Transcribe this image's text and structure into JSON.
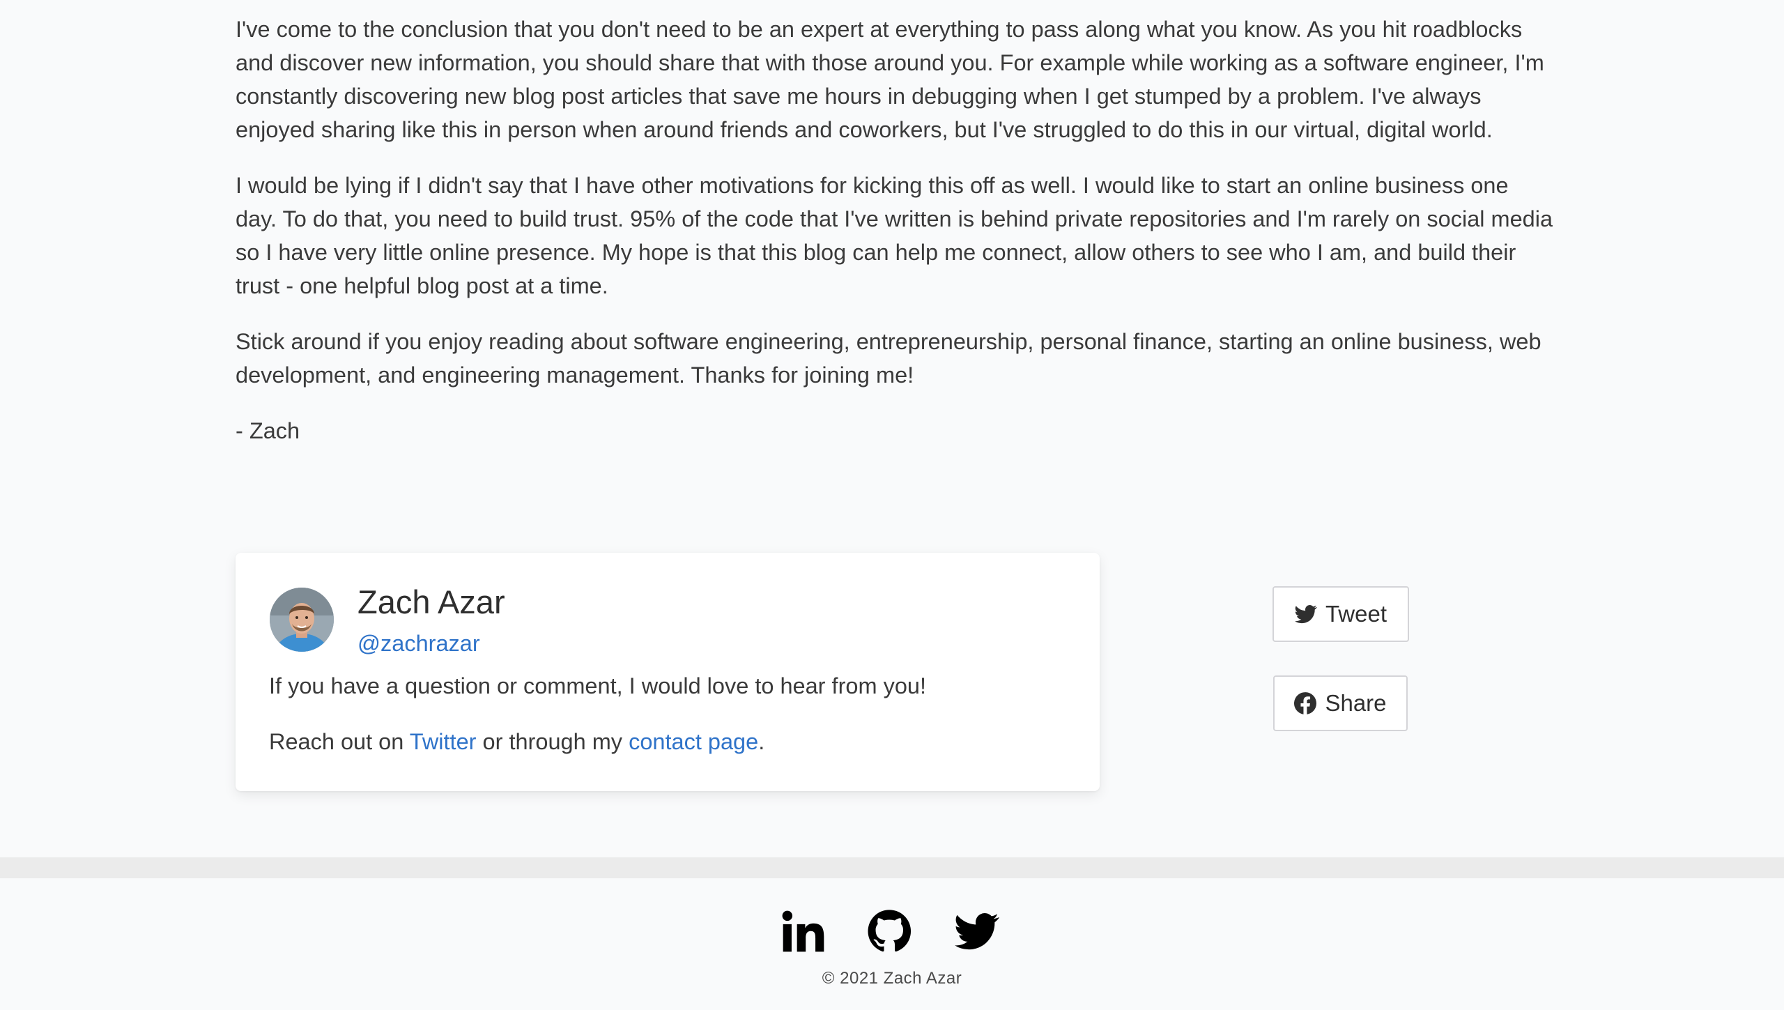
{
  "article": {
    "paragraphs": [
      "I've come to the conclusion that you don't need to be an expert at everything to pass along what you know. As you hit roadblocks and discover new information, you should share that with those around you. For example while working as a software engineer, I'm constantly discovering new blog post articles that save me hours in debugging when I get stumped by a problem. I've always enjoyed sharing like this in person when around friends and coworkers, but I've struggled to do this in our virtual, digital world.",
      "I would be lying if I didn't say that I have other motivations for kicking this off as well. I would like to start an online business one day. To do that, you need to build trust. 95% of the code that I've written is behind private repositories and I'm rarely on social media so I have very little online presence. My hope is that this blog can help me connect, allow others to see who I am, and build their trust - one helpful blog post at a time.",
      "Stick around if you enjoy reading about software engineering, entrepreneurship, personal finance, starting an online business, web development, and engineering management. Thanks for joining me!"
    ],
    "signature": "- Zach"
  },
  "author_card": {
    "name": "Zach Azar",
    "handle": "@zachrazar",
    "question_text": "If you have a question or comment, I would love to hear from you!",
    "reach_prefix": "Reach out on ",
    "twitter_link": "Twitter",
    "reach_middle": " or through my ",
    "contact_link": "contact page",
    "reach_suffix": "."
  },
  "share": {
    "tweet_label": "Tweet",
    "facebook_label": "Share"
  },
  "footer": {
    "social_icons": [
      "linkedin-icon",
      "github-icon",
      "twitter-icon"
    ],
    "copyright": "© 2021 Zach Azar"
  },
  "colors": {
    "link": "#2f73c9",
    "background": "#f9fafb",
    "card": "#ffffff",
    "footer_bar": "#ebebeb"
  }
}
